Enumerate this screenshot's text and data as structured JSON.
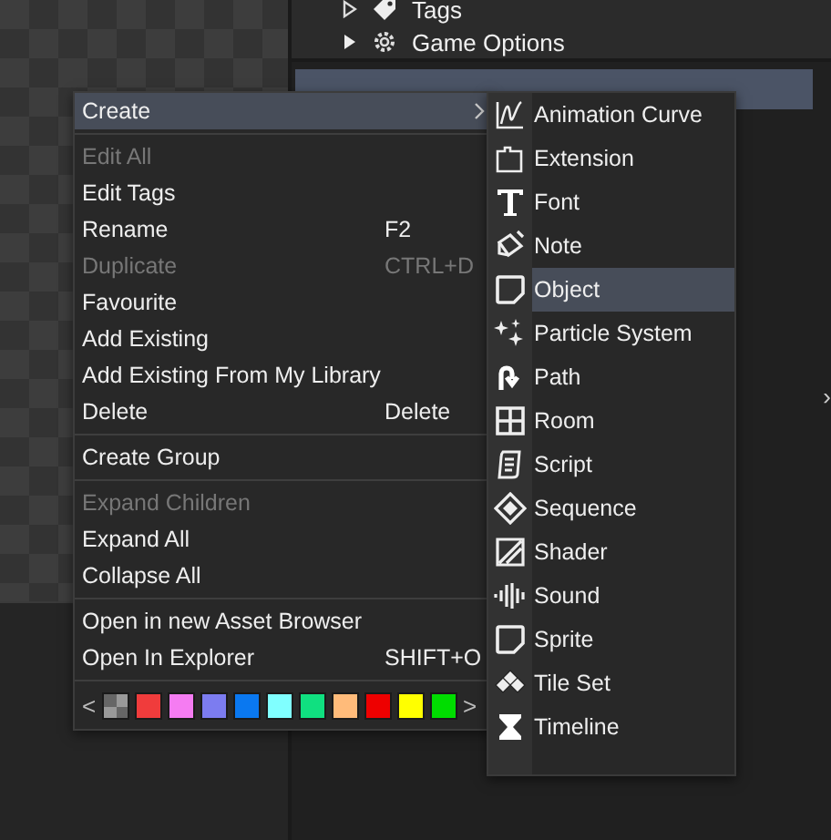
{
  "tree": {
    "items": [
      {
        "label": "Tags"
      },
      {
        "label": "Game Options"
      }
    ]
  },
  "context_menu": {
    "groups": [
      [
        {
          "label": "Create",
          "disabled": false,
          "selected": true,
          "submenu": true
        }
      ],
      [
        {
          "label": "Edit All",
          "disabled": true,
          "selected": false,
          "submenu": false
        },
        {
          "label": "Edit Tags",
          "disabled": false,
          "selected": false,
          "submenu": false
        },
        {
          "label": "Rename",
          "shortcut": "F2",
          "disabled": false,
          "selected": false,
          "submenu": false
        },
        {
          "label": "Duplicate",
          "shortcut": "CTRL+D",
          "disabled": true,
          "selected": false,
          "submenu": false
        },
        {
          "label": "Favourite",
          "disabled": false,
          "selected": false,
          "submenu": false
        },
        {
          "label": "Add Existing",
          "disabled": false,
          "selected": false,
          "submenu": false
        },
        {
          "label": "Add Existing From My Library",
          "disabled": false,
          "selected": false,
          "submenu": false
        },
        {
          "label": "Delete",
          "shortcut": "Delete",
          "disabled": false,
          "selected": false,
          "submenu": false
        }
      ],
      [
        {
          "label": "Create Group",
          "disabled": false,
          "selected": false,
          "submenu": false
        }
      ],
      [
        {
          "label": "Expand Children",
          "disabled": true,
          "selected": false,
          "submenu": false
        },
        {
          "label": "Expand All",
          "disabled": false,
          "selected": false,
          "submenu": false
        },
        {
          "label": "Collapse All",
          "disabled": false,
          "selected": false,
          "submenu": false
        }
      ],
      [
        {
          "label": "Open in new Asset Browser",
          "disabled": false,
          "selected": false,
          "submenu": false
        },
        {
          "label": "Open In Explorer",
          "shortcut": "SHIFT+O",
          "disabled": false,
          "selected": false,
          "submenu": false
        }
      ]
    ],
    "color_row": {
      "prev": "<",
      "next": ">",
      "swatches": [
        {
          "kind": "none"
        },
        {
          "kind": "color",
          "color": "#f03c3c"
        },
        {
          "kind": "color",
          "color": "#f57cf2"
        },
        {
          "kind": "color",
          "color": "#7c7cf0"
        },
        {
          "kind": "color",
          "color": "#0a78f0"
        },
        {
          "kind": "color",
          "color": "#80ffff"
        },
        {
          "kind": "color",
          "color": "#10e080"
        },
        {
          "kind": "color",
          "color": "#ffbb7a"
        },
        {
          "kind": "color",
          "color": "#ee0000"
        },
        {
          "kind": "color",
          "color": "#ffff00"
        },
        {
          "kind": "color",
          "color": "#00dd00"
        }
      ]
    }
  },
  "create_submenu": {
    "items": [
      {
        "label": "Animation Curve",
        "selected": false
      },
      {
        "label": "Extension",
        "selected": false
      },
      {
        "label": "Font",
        "selected": false
      },
      {
        "label": "Note",
        "selected": false
      },
      {
        "label": "Object",
        "selected": true
      },
      {
        "label": "Particle System",
        "selected": false
      },
      {
        "label": "Path",
        "selected": false
      },
      {
        "label": "Room",
        "selected": false
      },
      {
        "label": "Script",
        "selected": false
      },
      {
        "label": "Sequence",
        "selected": false
      },
      {
        "label": "Shader",
        "selected": false
      },
      {
        "label": "Sound",
        "selected": false
      },
      {
        "label": "Sprite",
        "selected": false
      },
      {
        "label": "Tile Set",
        "selected": false
      },
      {
        "label": "Timeline",
        "selected": false
      }
    ]
  },
  "side_arrow": "›"
}
